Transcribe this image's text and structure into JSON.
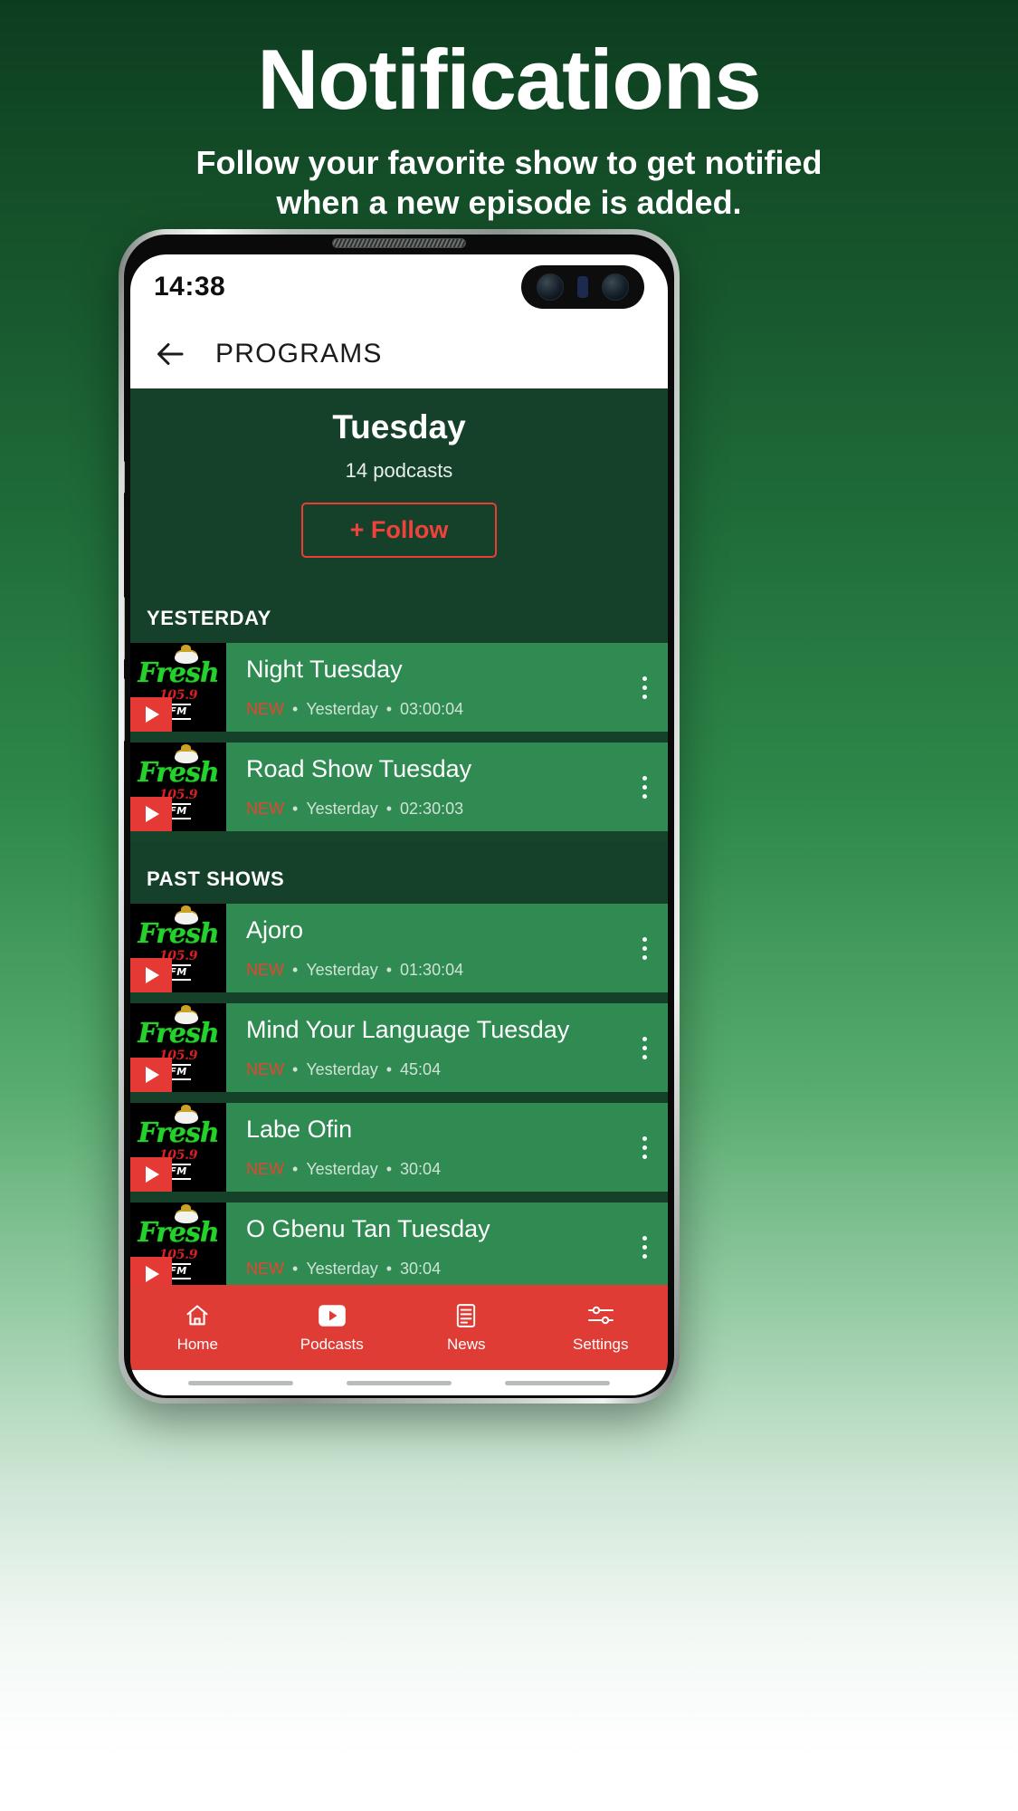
{
  "promo": {
    "title": "Notifications",
    "subtitle_line1": "Follow your favorite show to get notified",
    "subtitle_line2": "when a new episode is added."
  },
  "theme": {
    "accent_red": "#e8442f",
    "brand_green_dark": "#15412a",
    "brand_green_row": "#2f8b52",
    "nav_red": "#e03c36"
  },
  "status_bar": {
    "time": "14:38",
    "camera_icon": "front-camera-cutout"
  },
  "app_bar": {
    "back_icon": "arrow-left-icon",
    "title": "PROGRAMS"
  },
  "hero": {
    "title": "Tuesday",
    "count": "14 podcasts",
    "follow_button": "+ Follow"
  },
  "sections": [
    {
      "label": "YESTERDAY",
      "items": [
        {
          "title": "Night Tuesday",
          "badge": "NEW",
          "date": "Yesterday",
          "duration": "03:00:04",
          "thumb": {
            "station": "Fresh",
            "frequency": "105.9",
            "band": "FM",
            "play_icon": "play-icon"
          },
          "menu_icon": "kebab-menu-icon"
        },
        {
          "title": "Road Show Tuesday",
          "badge": "NEW",
          "date": "Yesterday",
          "duration": "02:30:03",
          "thumb": {
            "station": "Fresh",
            "frequency": "105.9",
            "band": "FM",
            "play_icon": "play-icon"
          },
          "menu_icon": "kebab-menu-icon"
        }
      ]
    },
    {
      "label": "PAST SHOWS",
      "items": [
        {
          "title": "Ajoro",
          "badge": "NEW",
          "date": "Yesterday",
          "duration": "01:30:04",
          "thumb": {
            "station": "Fresh",
            "frequency": "105.9",
            "band": "FM",
            "play_icon": "play-icon"
          },
          "menu_icon": "kebab-menu-icon"
        },
        {
          "title": "Mind Your Language Tuesday",
          "badge": "NEW",
          "date": "Yesterday",
          "duration": "45:04",
          "thumb": {
            "station": "Fresh",
            "frequency": "105.9",
            "band": "FM",
            "play_icon": "play-icon"
          },
          "menu_icon": "kebab-menu-icon"
        },
        {
          "title": "Labe Ofin",
          "badge": "NEW",
          "date": "Yesterday",
          "duration": "30:04",
          "thumb": {
            "station": "Fresh",
            "frequency": "105.9",
            "band": "FM",
            "play_icon": "play-icon"
          },
          "menu_icon": "kebab-menu-icon"
        },
        {
          "title": "O Gbenu Tan Tuesday",
          "badge": "NEW",
          "date": "Yesterday",
          "duration": "30:04",
          "thumb": {
            "station": "Fresh",
            "frequency": "105.9",
            "band": "FM",
            "play_icon": "play-icon"
          },
          "menu_icon": "kebab-menu-icon"
        }
      ]
    }
  ],
  "separator": "•",
  "bottom_nav": [
    {
      "label": "Home",
      "icon": "home-icon",
      "active": false
    },
    {
      "label": "Podcasts",
      "icon": "podcast-play-icon",
      "active": true
    },
    {
      "label": "News",
      "icon": "news-document-icon",
      "active": false
    },
    {
      "label": "Settings",
      "icon": "sliders-settings-icon",
      "active": false
    }
  ]
}
